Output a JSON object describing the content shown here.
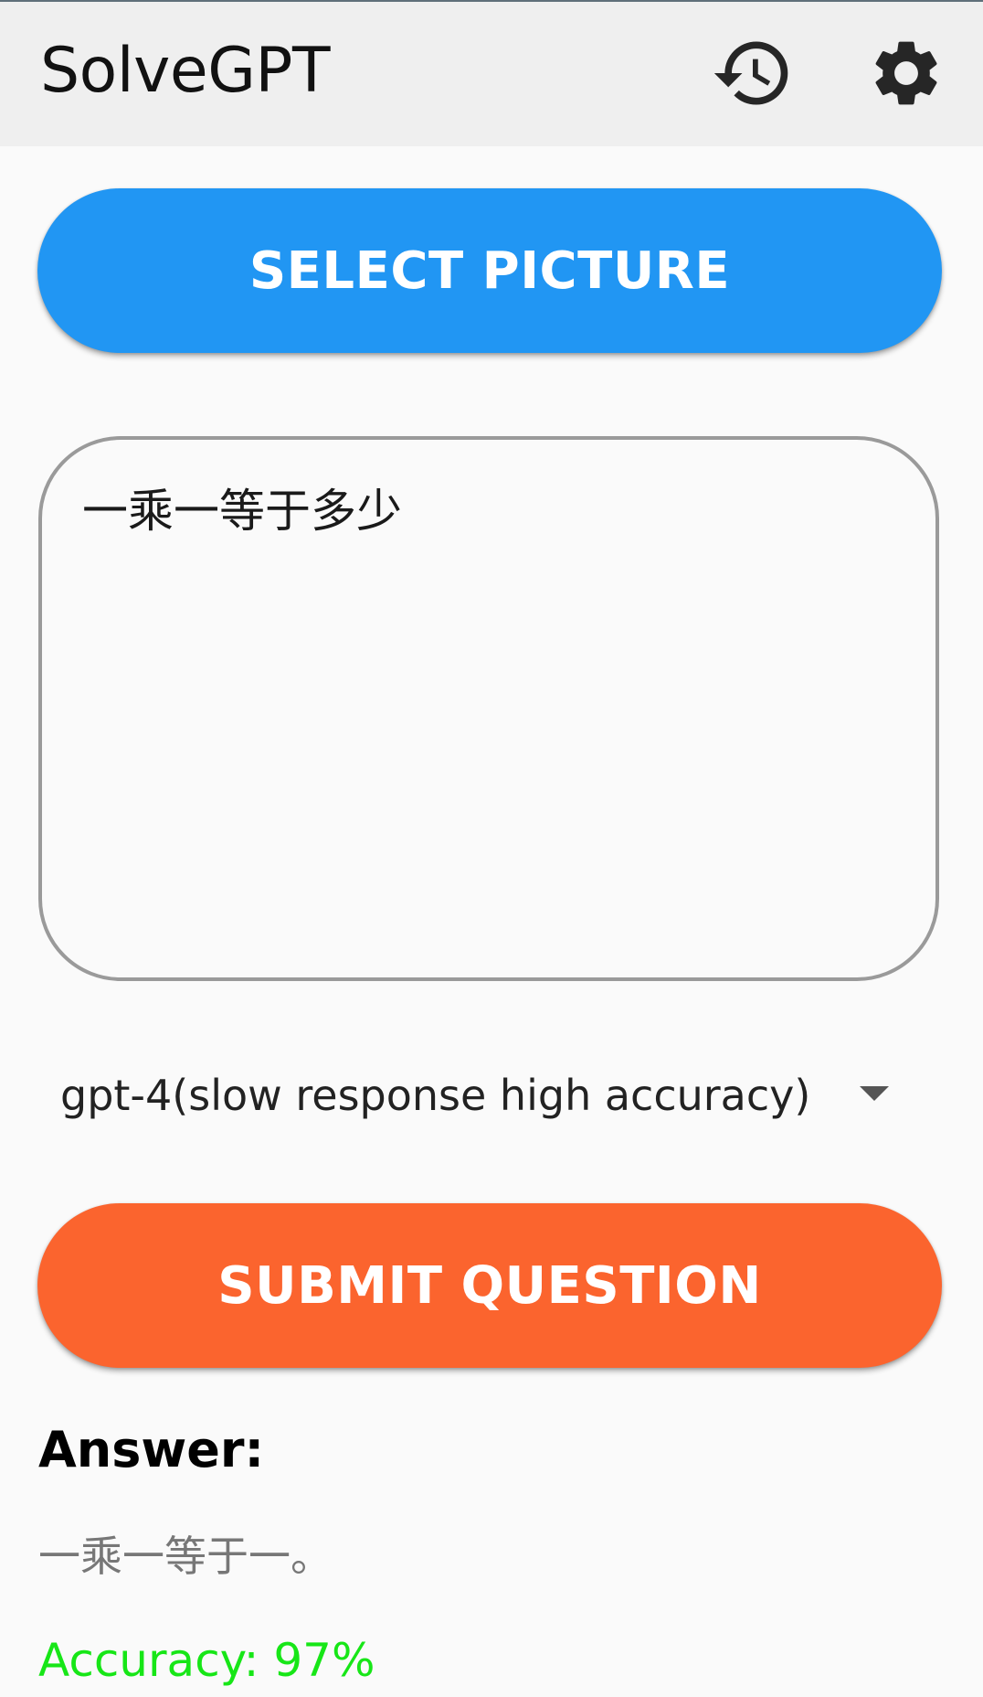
{
  "app_bar": {
    "title": "SolveGPT",
    "history_icon": "history-icon",
    "settings_icon": "gear-icon"
  },
  "select_picture": {
    "label": "SELECT PICTURE",
    "color": "#2196f3"
  },
  "question": {
    "value": "一乘一等于多少"
  },
  "model": {
    "selected": "gpt-4(slow response high accuracy)"
  },
  "submit": {
    "label": "SUBMIT QUESTION",
    "color": "#fb642e"
  },
  "answer": {
    "label": "Answer:",
    "text": "一乘一等于一。",
    "accuracy": "Accuracy: 97%",
    "accuracy_color": "#17e617"
  }
}
